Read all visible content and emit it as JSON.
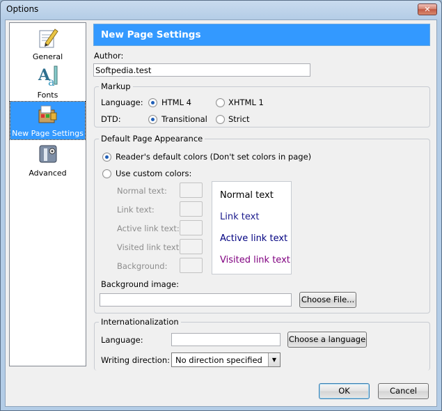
{
  "window": {
    "title": "Options",
    "close_symbol": "✕"
  },
  "sidebar": {
    "items": [
      {
        "label": "General",
        "icon": "pencil-paper-icon"
      },
      {
        "label": "Fonts",
        "icon": "fonts-icon"
      },
      {
        "label": "New Page Settings",
        "icon": "new-page-icon"
      },
      {
        "label": "Advanced",
        "icon": "advanced-icon"
      }
    ],
    "selected": "New Page Settings"
  },
  "header": {
    "title": "New Page Settings"
  },
  "author": {
    "label": "Author:",
    "value": "Softpedia.test"
  },
  "markup": {
    "title": "Markup",
    "language_label": "Language:",
    "language_options": [
      "HTML 4",
      "XHTML 1"
    ],
    "language_selected": "HTML 4",
    "dtd_label": "DTD:",
    "dtd_options": [
      "Transitional",
      "Strict"
    ],
    "dtd_selected": "Transitional"
  },
  "appearance": {
    "title": "Default Page Appearance",
    "option_default": "Reader's default colors (Don't set colors in page)",
    "option_custom": "Use custom colors:",
    "selected": "default",
    "color_labels": {
      "normal": "Normal text:",
      "link": "Link text:",
      "active": "Active link text:",
      "visited": "Visited link text:",
      "background": "Background:"
    },
    "preview": {
      "normal": "Normal text",
      "link": "Link text",
      "active": "Active link text",
      "visited": "Visited link text"
    },
    "preview_colors": {
      "normal": "#000000",
      "link": "#1a1a8c",
      "active": "#000080",
      "visited": "#800080"
    },
    "background_image_label": "Background image:",
    "background_image_value": "",
    "choose_file_button": "Choose File..."
  },
  "internationalization": {
    "title": "Internationalization",
    "language_label": "Language:",
    "language_value": "",
    "choose_language_button": "Choose a language",
    "writing_direction_label": "Writing direction:",
    "writing_direction_value": "No direction specified"
  },
  "buttons": {
    "ok": "OK",
    "cancel": "Cancel"
  },
  "colors": {
    "accent": "#3399ff",
    "selection": "#3399ff"
  }
}
